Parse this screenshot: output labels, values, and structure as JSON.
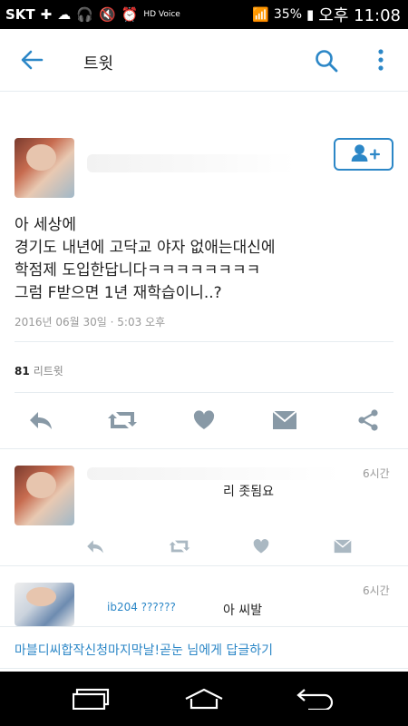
{
  "status_bar": {
    "carrier": "SKT",
    "battery": "35%",
    "time": "오후 11:08",
    "hd_voice": "HD Voice",
    "icons": [
      "plus-icon",
      "cloud-icon",
      "headset-icon",
      "mute-icon",
      "alarm-icon",
      "hd-voice-icon",
      "wifi-icon",
      "signal-icon",
      "battery-icon"
    ]
  },
  "app_bar": {
    "title": "트윗",
    "icons": [
      "back-arrow-icon",
      "search-icon",
      "more-vertical-icon"
    ]
  },
  "tweet": {
    "text": "아 세상에\n경기도 내년에 고닥교 야자 없애는대신에\n학점제 도입한답니다ㅋㅋㅋㅋㅋㅋㅋㅋ\n그럼 F받으면 1년 재학습이니..?",
    "date": "2016년 06월 30일 · 5:03 오후",
    "retweet_count": "81",
    "retweet_label": "리트윗",
    "actions": [
      "reply-icon",
      "retweet-icon",
      "like-icon",
      "dm-icon",
      "share-icon"
    ]
  },
  "replies": [
    {
      "time": "6시간",
      "text": "리 좃됨요"
    },
    {
      "time": "6시간",
      "text": "아 씨발",
      "partial_handle": "ib204 ??????"
    }
  ],
  "reply_to": "마블디씨합작신청마지막날!곧눈 님에게 답글하기",
  "accent": "#2c87c7"
}
